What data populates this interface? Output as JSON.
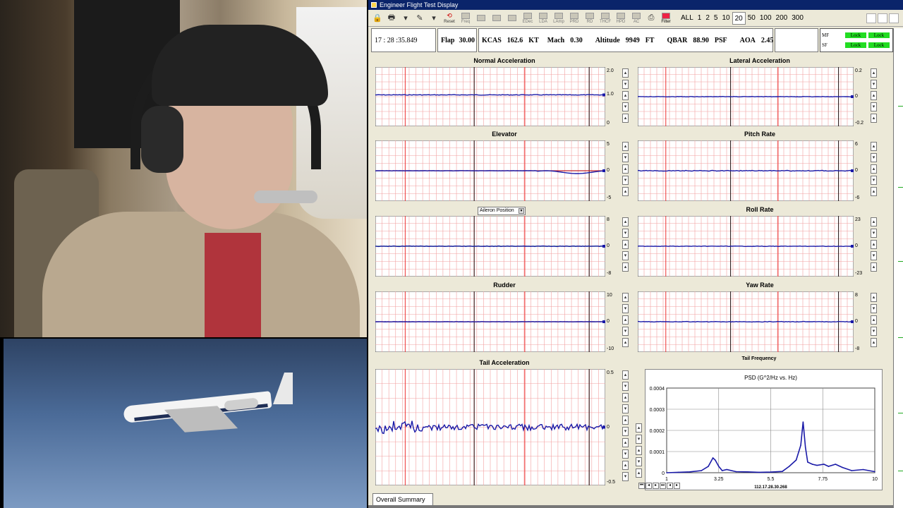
{
  "window": {
    "title": "Engineer Flight Test Display"
  },
  "toolbar": {
    "reset_label": "Reset",
    "disabled_tools": [
      "Freq",
      "",
      "",
      "",
      "EDec",
      "LDA",
      "LAmp",
      "PRD",
      "RD",
      "THCF",
      "HPD",
      "AC"
    ],
    "filter_label": "Filter",
    "zoom_options": [
      "ALL",
      "1",
      "2",
      "5",
      "10",
      "20",
      "50",
      "100",
      "200",
      "300"
    ],
    "zoom_selected": "20"
  },
  "status": {
    "time": "17 : 28 :35.849",
    "flap_label": "Flap",
    "flap_value": "30.00",
    "kcas_label": "KCAS",
    "kcas_value": "162.6",
    "kcas_unit": "KT",
    "mach_label": "Mach",
    "mach_value": "0.30",
    "altitude_label": "Altitude",
    "altitude_value": "9949",
    "altitude_unit": "FT",
    "qbar_label": "QBAR",
    "qbar_value": "88.90",
    "qbar_unit": "PSF",
    "aoa_label": "AOA",
    "aoa_value": "2.45",
    "locks": [
      {
        "label": "MF",
        "a": "Lock",
        "b": "Lock"
      },
      {
        "label": "SF",
        "a": "Lock",
        "b": "Lock"
      }
    ]
  },
  "charts": [
    {
      "id": "normal-acceleration",
      "title": "Normal Acceleration",
      "y_top": "2.0",
      "y_mid": "1.0",
      "y_bot": "0",
      "trace_level": 0.47,
      "noise": 0.4,
      "color": "#1a1aa8"
    },
    {
      "id": "lateral-acceleration",
      "title": "Lateral Acceleration",
      "y_top": "0.2",
      "y_mid": "0",
      "y_bot": "-0.2",
      "trace_level": 0.5,
      "noise": 0.3,
      "color": "#1a1aa8"
    },
    {
      "id": "elevator",
      "title": "Elevator",
      "y_top": "5",
      "y_mid": "0",
      "y_bot": "-5",
      "trace_level": 0.5,
      "noise": 0.2,
      "color": "#1a1aa8",
      "color2": "#c0202a"
    },
    {
      "id": "pitch-rate",
      "title": "Pitch Rate",
      "y_top": "6",
      "y_mid": "0",
      "y_bot": "-6",
      "trace_level": 0.5,
      "noise": 0.5,
      "color": "#1a1aa8"
    },
    {
      "id": "aileron-position",
      "title": "",
      "y_top": "8",
      "y_mid": "0",
      "y_bot": "-8",
      "trace_level": 0.5,
      "noise": 0.4,
      "color": "#1a1aa8",
      "color2": "#1c8a2a"
    },
    {
      "id": "roll-rate",
      "title": "Roll Rate",
      "y_top": "23",
      "y_mid": "0",
      "y_bot": "-23",
      "trace_level": 0.5,
      "noise": 0.3,
      "color": "#1a1aa8"
    },
    {
      "id": "rudder",
      "title": "Rudder",
      "y_top": "10",
      "y_mid": "0",
      "y_bot": "-10",
      "trace_level": 0.5,
      "noise": 0.2,
      "color": "#1a1aa8",
      "color2": "#c0202a"
    },
    {
      "id": "yaw-rate",
      "title": "Yaw Rate",
      "y_top": "8",
      "y_mid": "0",
      "y_bot": "-8",
      "trace_level": 0.5,
      "noise": 0.4,
      "color": "#1a1aa8"
    },
    {
      "id": "tail-acceleration",
      "title": "Tail Acceleration",
      "y_top": "0.5",
      "y_mid": "0",
      "y_bot": "-0.5",
      "trace_level": 0.5,
      "noise": 3.5,
      "color": "#1a1aa8"
    }
  ],
  "aileron_select": {
    "value": "Aileron Position"
  },
  "psd": {
    "panel_title": "Tail Frequency",
    "plot_title": "PSD  (G^2/Hz vs. Hz)",
    "y_ticks": [
      "0.0004",
      "0.0003",
      "0.0002",
      "0.0001",
      "0"
    ],
    "x_ticks": [
      "1",
      "3.25",
      "5.5",
      "7.75",
      "10"
    ],
    "timestamp": "112.17.28.30.268"
  },
  "chart_data": {
    "type": "line",
    "title": "PSD  (G^2/Hz vs. Hz)",
    "xlabel": "",
    "ylabel": "",
    "xlim": [
      1,
      10
    ],
    "ylim": [
      0,
      0.0004
    ],
    "x": [
      1.0,
      1.5,
      2.0,
      2.5,
      2.8,
      3.0,
      3.1,
      3.25,
      3.4,
      3.6,
      4.0,
      4.5,
      5.0,
      5.5,
      6.0,
      6.3,
      6.6,
      6.8,
      6.9,
      7.0,
      7.1,
      7.3,
      7.5,
      7.8,
      8.0,
      8.3,
      8.6,
      9.0,
      9.5,
      10.0
    ],
    "series": [
      {
        "values": [
          0.0,
          2e-06,
          4e-06,
          1e-05,
          3e-05,
          7e-05,
          6e-05,
          3e-05,
          1e-05,
          1.5e-05,
          5e-06,
          4e-06,
          2e-06,
          3e-06,
          6e-06,
          3e-05,
          6e-05,
          0.00013,
          0.00024,
          0.00012,
          5e-05,
          4e-05,
          3.5e-05,
          4e-05,
          3e-05,
          4e-05,
          2.5e-05,
          1e-05,
          1.5e-05,
          5e-06
        ]
      }
    ]
  },
  "bottom": {
    "tab_label": "Overall Summary"
  }
}
